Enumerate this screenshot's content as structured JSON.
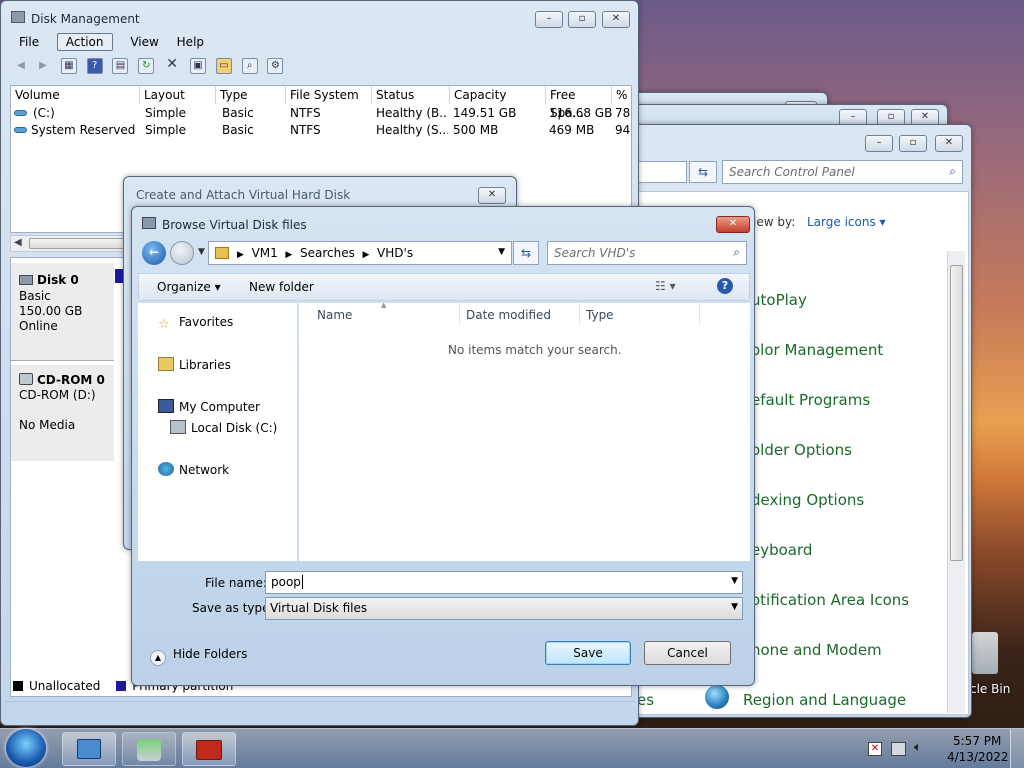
{
  "disk_mgmt": {
    "title": "Disk Management",
    "menu": [
      "File",
      "Action",
      "View",
      "Help"
    ],
    "columns": [
      "Volume",
      "Layout",
      "Type",
      "File System",
      "Status",
      "Capacity",
      "Free Spa...",
      "% F"
    ],
    "rows": [
      [
        "(C:)",
        "Simple",
        "Basic",
        "NTFS",
        "Healthy (B...",
        "149.51 GB",
        "116.68 GB",
        "78"
      ],
      [
        "System Reserved",
        "Simple",
        "Basic",
        "NTFS",
        "Healthy (S...",
        "500 MB",
        "469 MB",
        "94"
      ]
    ],
    "disk0": {
      "name": "Disk 0",
      "type": "Basic",
      "size": "150.00 GB",
      "state": "Online"
    },
    "cdrom": {
      "name": "CD-ROM 0",
      "drive": "CD-ROM (D:)",
      "media": "No Media"
    },
    "legend": [
      "Unallocated",
      "Primary partition"
    ]
  },
  "control_panel": {
    "search_placeholder": "Search Control Panel",
    "view_by_label": "iew by:",
    "view_by_value": "Large icons",
    "items": [
      "utoPlay",
      "olor Management",
      "efault Programs",
      "older Options",
      "dexing Options",
      "eyboard",
      "otification Area Icons",
      "hone and Modem",
      "Region and Language"
    ],
    "partial_left": "es"
  },
  "attach_dialog": {
    "title": "Create and Attach Virtual Hard Disk"
  },
  "browse": {
    "title": "Browse Virtual Disk files",
    "breadcrumb": [
      "VM1",
      "Searches",
      "VHD's"
    ],
    "search_placeholder": "Search VHD's",
    "organize": "Organize",
    "new_folder": "New folder",
    "nav": [
      "Favorites",
      "Libraries",
      "My Computer",
      "Local Disk (C:)",
      "Network"
    ],
    "columns": [
      "Name",
      "Date modified",
      "Type"
    ],
    "empty_msg": "No items match your search.",
    "file_name_label": "File name:",
    "file_name_value": "poop",
    "save_type_label": "Save as type:",
    "save_type_value": "Virtual Disk files",
    "hide_folders": "Hide Folders",
    "save": "Save",
    "cancel": "Cancel"
  },
  "desktop": {
    "recycle_label": "cle Bin"
  },
  "taskbar": {
    "time": "5:57 PM",
    "date": "4/13/2022"
  }
}
